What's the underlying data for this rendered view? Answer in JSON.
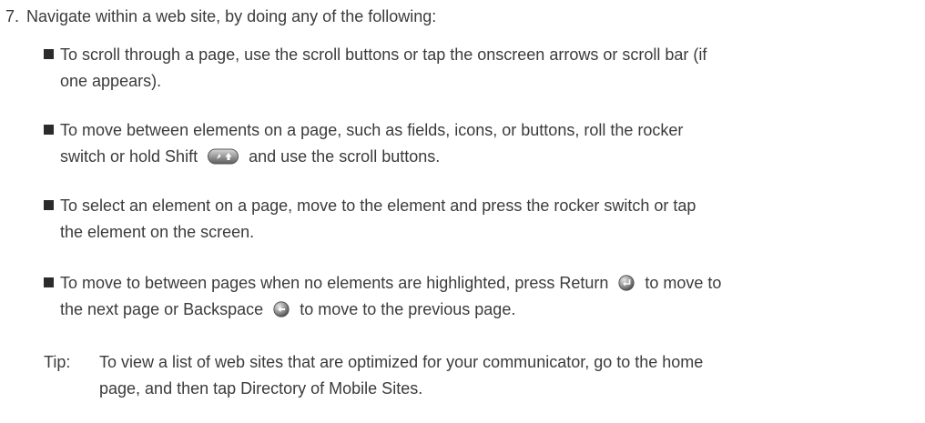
{
  "step": {
    "number": "7.",
    "text": "Navigate within a web site, by doing any of the following:"
  },
  "bullets": [
    {
      "line1": "To scroll through a page, use the scroll buttons or tap the onscreen arrows or scroll bar (if",
      "line2": "one appears)."
    },
    {
      "line1": "To move between elements on a page, such as fields, icons, or buttons, roll the rocker",
      "line2_before": "switch or hold Shift",
      "line2_after": "and use the scroll buttons.",
      "icon": "shift-key-icon"
    },
    {
      "line1": "To select an element on a page, move to the element and press the rocker switch or tap",
      "line2": "the element on the screen."
    },
    {
      "line1_before": "To move to between pages when no elements are highlighted, press Return",
      "line1_after": "to move to",
      "line2_before": "the next page or Backspace",
      "line2_after": "to move to the previous page.",
      "icons": [
        "return-key-icon",
        "backspace-key-icon"
      ]
    }
  ],
  "tip": {
    "label": "Tip:",
    "line1": "To view a list of web sites that are optimized for your communicator, go to the home",
    "line2": "page, and then tap Directory of Mobile Sites."
  }
}
